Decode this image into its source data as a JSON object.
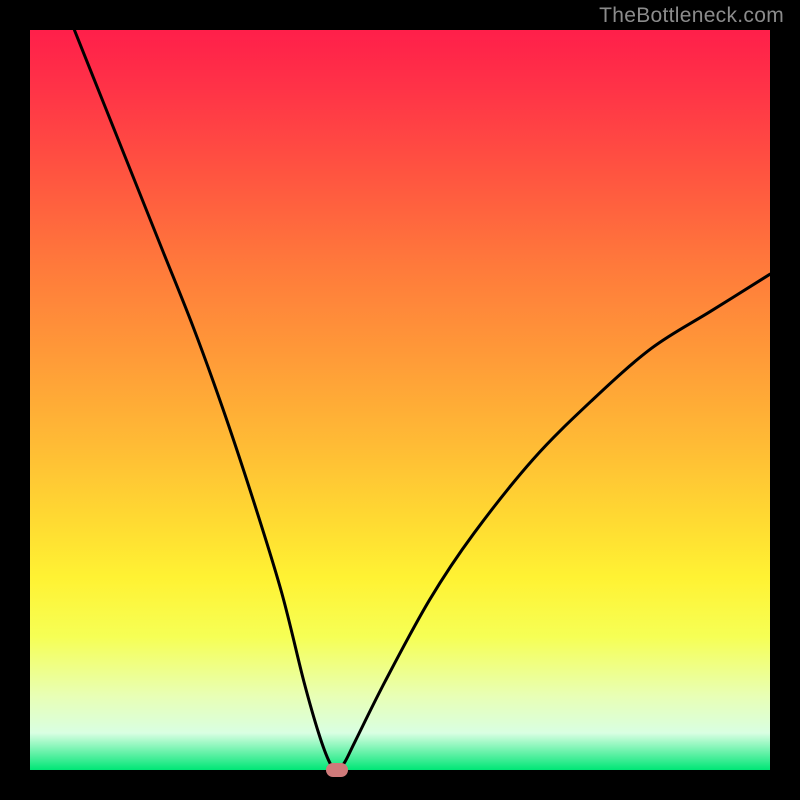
{
  "watermark": "TheBottleneck.com",
  "colors": {
    "marker": "#cf7a7a",
    "curve_stroke": "#000000"
  },
  "chart_data": {
    "type": "line",
    "title": "",
    "xlabel": "",
    "ylabel": "",
    "xlim": [
      0,
      100
    ],
    "ylim": [
      0,
      100
    ],
    "grid": false,
    "legend": false,
    "series": [
      {
        "name": "bottleneck-curve",
        "x": [
          6,
          10,
          14,
          18,
          22,
          26,
          30,
          34,
          37,
          39,
          40.5,
          41.5,
          42.5,
          44,
          48,
          54,
          60,
          68,
          76,
          84,
          92,
          100
        ],
        "y": [
          100,
          90,
          80,
          70,
          60,
          49,
          37,
          24,
          12,
          5,
          1,
          0,
          1,
          4,
          12,
          23,
          32,
          42,
          50,
          57,
          62,
          67
        ]
      }
    ],
    "marker": {
      "x": 41.5,
      "y": 0
    }
  }
}
